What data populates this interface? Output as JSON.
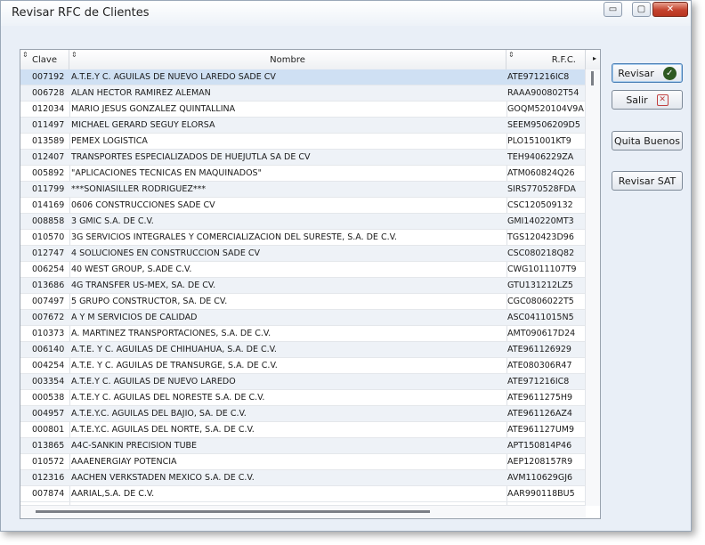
{
  "window": {
    "title": "Revisar RFC de Clientes",
    "controls": {
      "minimize": "▭",
      "maximize": "▢",
      "close": "✕"
    }
  },
  "grid": {
    "columns": {
      "clave": "Clave",
      "nombre": "Nombre",
      "rfc": "R.F.C."
    },
    "sort_indicator": "⇕",
    "scroll_right_arrow": "▸",
    "rows": [
      {
        "clave": "007192",
        "nombre": "A.T.E.Y C. AGUILAS DE NUEVO LAREDO SADE CV",
        "rfc": "ATE971216IC8"
      },
      {
        "clave": "006728",
        "nombre": "ALAN HECTOR RAMIREZ ALEMAN",
        "rfc": "RAAA900802T54"
      },
      {
        "clave": "012034",
        "nombre": "MARIO JESUS GONZALEZ QUINTALLINA",
        "rfc": "GOQM520104V9A"
      },
      {
        "clave": "011497",
        "nombre": "MICHAEL GERARD SEGUY ELORSA",
        "rfc": "SEEM9506209D5"
      },
      {
        "clave": "013589",
        "nombre": "PEMEX LOGISTICA",
        "rfc": "PLO151001KT9"
      },
      {
        "clave": "012407",
        "nombre": "TRANSPORTES ESPECIALIZADOS DE HUEJUTLA SA DE CV",
        "rfc": "TEH9406229ZA"
      },
      {
        "clave": "005892",
        "nombre": "\"APLICACIONES TECNICAS EN MAQUINADOS\"",
        "rfc": "ATM060824Q26"
      },
      {
        "clave": "011799",
        "nombre": "***SONIASILLER RODRIGUEZ***",
        "rfc": "SIRS770528FDA"
      },
      {
        "clave": "014169",
        "nombre": "0606 CONSTRUCCIONES SADE CV",
        "rfc": "CSC120509132"
      },
      {
        "clave": "008858",
        "nombre": "3 GMIC S.A. DE C.V.",
        "rfc": "GMI140220MT3"
      },
      {
        "clave": "010570",
        "nombre": "3G SERVICIOS INTEGRALES Y COMERCIALIZACION DEL SURESTE, S.A. DE C.V.",
        "rfc": "TGS120423D96"
      },
      {
        "clave": "012747",
        "nombre": "4 SOLUCIONES EN CONSTRUCCION SADE CV",
        "rfc": "CSC080218Q82"
      },
      {
        "clave": "006254",
        "nombre": "40 WEST GROUP, S.ADE C.V.",
        "rfc": "CWG1011107T9"
      },
      {
        "clave": "013686",
        "nombre": "4G TRANSFER US-MEX, SA. DE CV.",
        "rfc": "GTU131212LZ5"
      },
      {
        "clave": "007497",
        "nombre": "5 GRUPO CONSTRUCTOR, SA. DE CV.",
        "rfc": "CGC0806022T5"
      },
      {
        "clave": "007672",
        "nombre": "A Y M SERVICIOS DE CALIDAD",
        "rfc": "ASC0411015N5"
      },
      {
        "clave": "010373",
        "nombre": "A. MARTINEZ TRANSPORTACIONES, S.A. DE C.V.",
        "rfc": "AMT090617D24"
      },
      {
        "clave": "006140",
        "nombre": "A.T.E. Y C. AGUILAS DE CHIHUAHUA, S.A. DE C.V.",
        "rfc": "ATE961126929"
      },
      {
        "clave": "004254",
        "nombre": "A.T.E. Y C. AGUILAS DE TRANSURGE, S.A. DE C.V.",
        "rfc": "ATE080306R47"
      },
      {
        "clave": "003354",
        "nombre": "A.T.E.Y C. AGUILAS DE NUEVO LAREDO",
        "rfc": "ATE971216IC8"
      },
      {
        "clave": "000538",
        "nombre": "A.T.E.Y C. AGUILAS DEL NORESTE S.A. DE C.V.",
        "rfc": "ATE9611275H9"
      },
      {
        "clave": "004957",
        "nombre": "A.T.E.Y.C. AGUILAS DEL BAJIO, SA. DE C.V.",
        "rfc": "ATE961126AZ4"
      },
      {
        "clave": "000801",
        "nombre": "A.T.E.Y.C. AGUILAS DEL NORTE, S.A. DE C.V.",
        "rfc": "ATE961127UM9"
      },
      {
        "clave": "013865",
        "nombre": "A4C-SANKIN PRECISION TUBE",
        "rfc": "APT150814P46"
      },
      {
        "clave": "010572",
        "nombre": "AAAENERGIAY POTENCIA",
        "rfc": "AEP1208157R9"
      },
      {
        "clave": "012316",
        "nombre": "AACHEN VERKSTADEN MEXICO S.A. DE C.V.",
        "rfc": "AVM110629GJ6"
      },
      {
        "clave": "007874",
        "nombre": "AARIAL,S.A. DE C.V.",
        "rfc": "AAR990118BU5"
      }
    ]
  },
  "buttons": {
    "revisar": "Revisar",
    "salir": "Salir",
    "quita_buenos": "Quita Buenos",
    "revisar_sat": "Revisar SAT"
  },
  "icons": {
    "check": "✓",
    "cancel": "✕"
  }
}
